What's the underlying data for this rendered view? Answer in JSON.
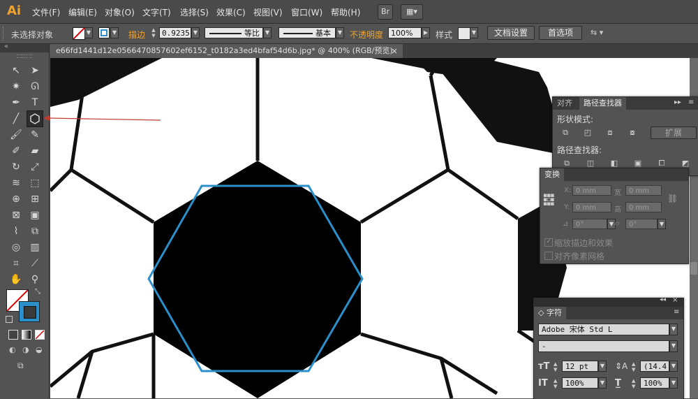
{
  "app": {
    "logo": "Ai"
  },
  "menu": [
    "文件(F)",
    "编辑(E)",
    "对象(O)",
    "文字(T)",
    "选择(S)",
    "效果(C)",
    "视图(V)",
    "窗口(W)",
    "帮助(H)"
  ],
  "menubar_buttons": {
    "bridge": "Br"
  },
  "control_bar": {
    "selection_label": "未选择对象",
    "stroke_label": "描边",
    "stroke_weight": "0.9235",
    "stroke_profile": "等比",
    "brush": "基本",
    "opacity_label": "不透明度",
    "opacity_value": "100%",
    "style_label": "样式",
    "doc_setup_button": "文档设置",
    "preferences_button": "首选项",
    "accent_color": "#f0a32c"
  },
  "document_tab": {
    "title": "e66fd1441d12e0566470857602ef6152_t0182a3ed4bfaf54d6b.jpg*  @  400%  (RGB/预览)",
    "close": "×"
  },
  "pathfinder_panel": {
    "tabs": [
      "对齐",
      "路径查找器"
    ],
    "active_tab": "路径查找器",
    "shape_modes_label": "形状模式:",
    "expand_button": "扩展",
    "pathfinders_label": "路径查找器:"
  },
  "transform_panel": {
    "tab": "变换",
    "x_label": "X:",
    "x_value": "0 mm",
    "y_label": "Y:",
    "y_value": "0 mm",
    "w_label": "宽",
    "w_value": "0 mm",
    "h_label": "高",
    "h_value": "0 mm",
    "rotate_value": "0°",
    "shear_value": "0°",
    "scale_strokes_label": "缩放描边和效果",
    "align_pixel_label": "对齐像素网格"
  },
  "character_panel": {
    "tab": "字符",
    "font_family": "Adobe 宋体 Std L",
    "font_style": "-",
    "font_size": "12 pt",
    "leading": "(14.4",
    "vertical_scale": "100%",
    "horizontal_scale": "100%"
  },
  "colors": {
    "hexagon_stroke": "#2b8fc9",
    "annotation_arrow": "#c0392b",
    "stroke_swatch": "#2b8fc9"
  }
}
